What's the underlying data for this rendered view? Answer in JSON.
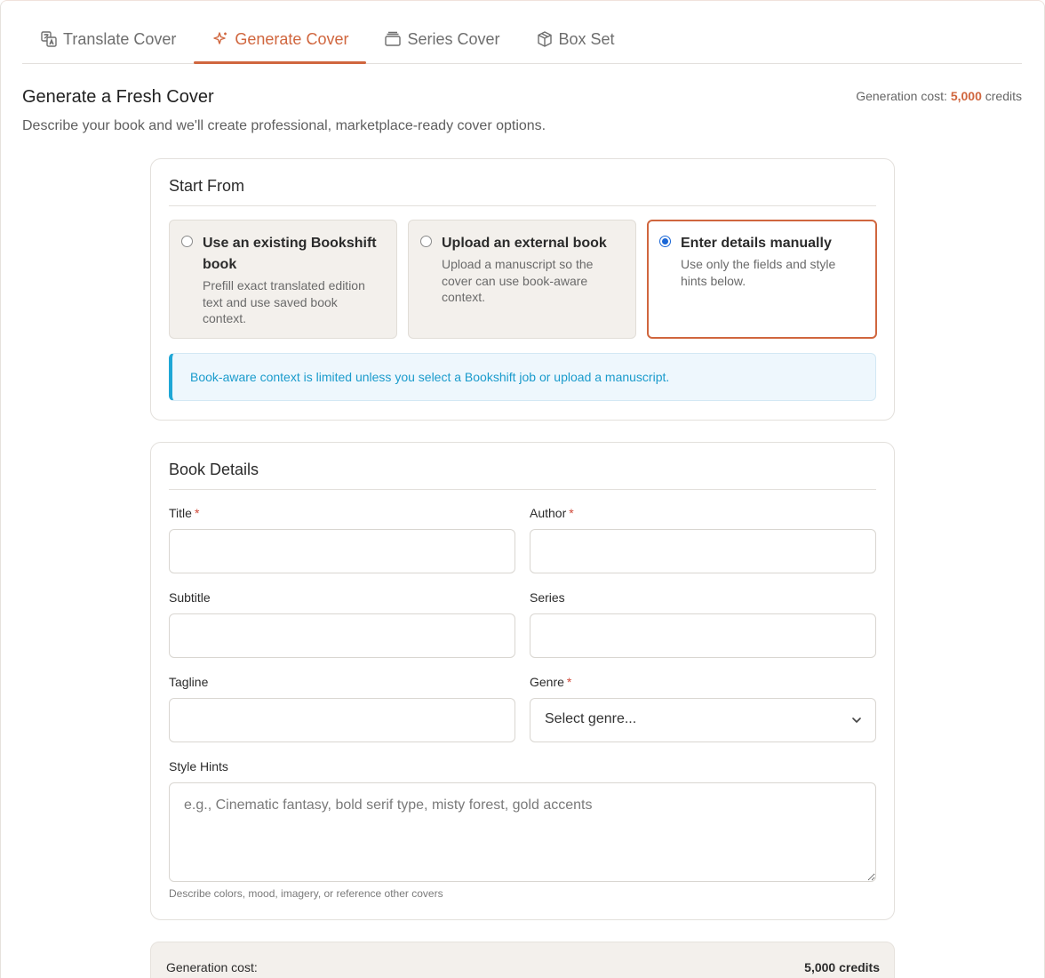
{
  "tabs": [
    {
      "label": "Translate Cover",
      "icon": "translate-icon"
    },
    {
      "label": "Generate Cover",
      "icon": "sparkle-icon"
    },
    {
      "label": "Series Cover",
      "icon": "stack-icon"
    },
    {
      "label": "Box Set",
      "icon": "box-icon"
    }
  ],
  "active_tab": "Generate Cover",
  "header": {
    "title": "Generate a Fresh Cover",
    "description": "Describe your book and we'll create professional, marketplace-ready cover options.",
    "cost_label": "Generation cost:",
    "cost_amount": "5,000",
    "cost_unit": "credits"
  },
  "start_from": {
    "title": "Start From",
    "options": [
      {
        "title": "Use an existing Bookshift book",
        "description": "Prefill exact translated edition text and use saved book context.",
        "selected": false
      },
      {
        "title": "Upload an external book",
        "description": "Upload a manuscript so the cover can use book-aware context.",
        "selected": false
      },
      {
        "title": "Enter details manually",
        "description": "Use only the fields and style hints below.",
        "selected": true
      }
    ],
    "info": "Book-aware context is limited unless you select a Bookshift job or upload a manuscript."
  },
  "book_details": {
    "title": "Book Details",
    "required_mark": "*",
    "fields": {
      "title": {
        "label": "Title",
        "value": ""
      },
      "author": {
        "label": "Author",
        "value": ""
      },
      "subtitle": {
        "label": "Subtitle",
        "value": ""
      },
      "series": {
        "label": "Series",
        "value": ""
      },
      "tagline": {
        "label": "Tagline",
        "value": ""
      },
      "genre": {
        "label": "Genre",
        "selected": "Select genre..."
      },
      "style_hints": {
        "label": "Style Hints",
        "placeholder": "e.g., Cinematic fantasy, bold serif type, misty forest, gold accents",
        "hint": "Describe colors, mood, imagery, or reference other covers"
      }
    }
  },
  "cost_bar": {
    "label": "Generation cost:",
    "value": "5,000 credits"
  },
  "colors": {
    "accent": "#d0663e",
    "info": "#1fa7d6",
    "radio": "#1a66d6",
    "required": "#d04a3a"
  }
}
